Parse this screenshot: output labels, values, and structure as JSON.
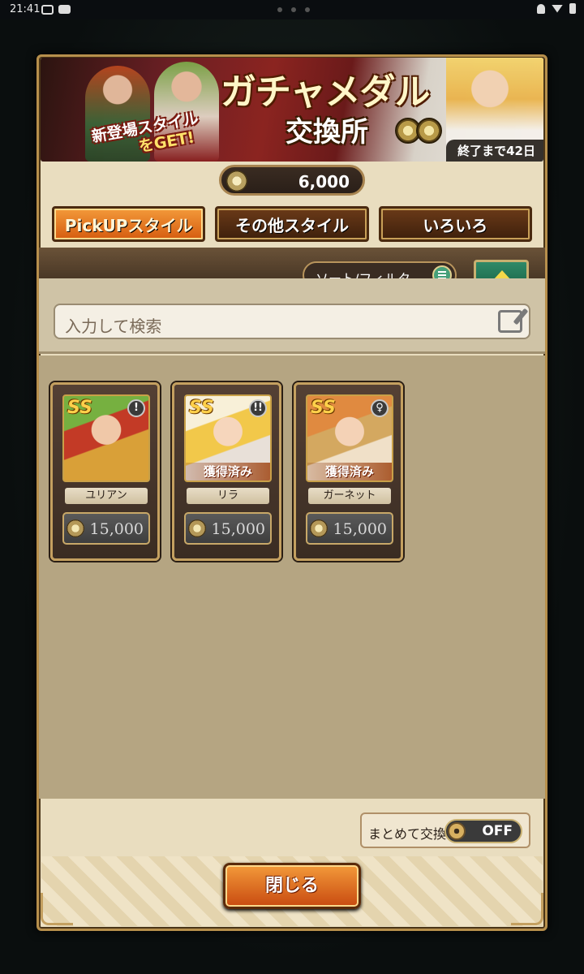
{
  "status_bar": {
    "time": "21:41"
  },
  "banner": {
    "title": "ガチャメダル",
    "subtitle": "交換所",
    "new_style_line1": "新登場スタイル",
    "new_style_line2": "をGET!",
    "deadline": "終了まで42日"
  },
  "currency": {
    "amount": "6,000",
    "icon": "medal-coin-icon"
  },
  "tabs": [
    {
      "label": "PickUPスタイル",
      "active": true
    },
    {
      "label": "その他スタイル",
      "active": false
    },
    {
      "label": "いろいろ",
      "active": false
    }
  ],
  "sort_filter": {
    "label": "ソート/フィルタ"
  },
  "search": {
    "placeholder": "入力して検索"
  },
  "cards": [
    {
      "name": "ユリアン",
      "rank": "SS",
      "type_icon": "!",
      "owned": "",
      "price": "15,000"
    },
    {
      "name": "リラ",
      "rank": "SS",
      "type_icon": "!!",
      "owned": "獲得済み",
      "price": "15,000"
    },
    {
      "name": "ガーネット",
      "rank": "SS",
      "type_icon": "♀",
      "owned": "獲得済み",
      "price": "15,000"
    }
  ],
  "bulk_exchange": {
    "label": "まとめて交換",
    "state": "OFF"
  },
  "close_button": {
    "label": "閉じる"
  },
  "colors": {
    "accent_orange": "#e8741e",
    "teal_button": "#2f8a68",
    "panel_bg": "#e9ddbf",
    "frame_gold": "#b78f4c"
  }
}
